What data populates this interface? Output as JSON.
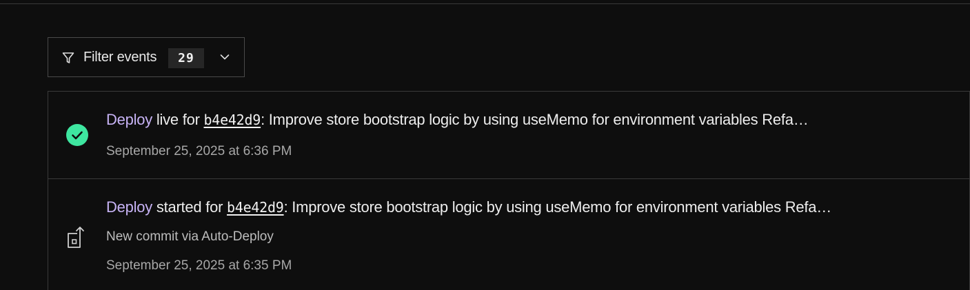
{
  "filter": {
    "label": "Filter events",
    "count": "29"
  },
  "events": [
    {
      "type": "deploy-live",
      "kind_label": "Deploy",
      "action_text": " live for ",
      "commit": "b4e42d9",
      "message": ": Improve store bootstrap logic by using useMemo for environment variables Refa…",
      "subtitle": "",
      "timestamp": "September 25, 2025 at 6:36 PM",
      "status_color": "#3ee6a0"
    },
    {
      "type": "deploy-started",
      "kind_label": "Deploy",
      "action_text": " started for ",
      "commit": "b4e42d9",
      "message": ": Improve store bootstrap logic by using useMemo for environment variables Refa…",
      "subtitle": "New commit via Auto-Deploy",
      "timestamp": "September 25, 2025 at 6:35 PM"
    }
  ]
}
